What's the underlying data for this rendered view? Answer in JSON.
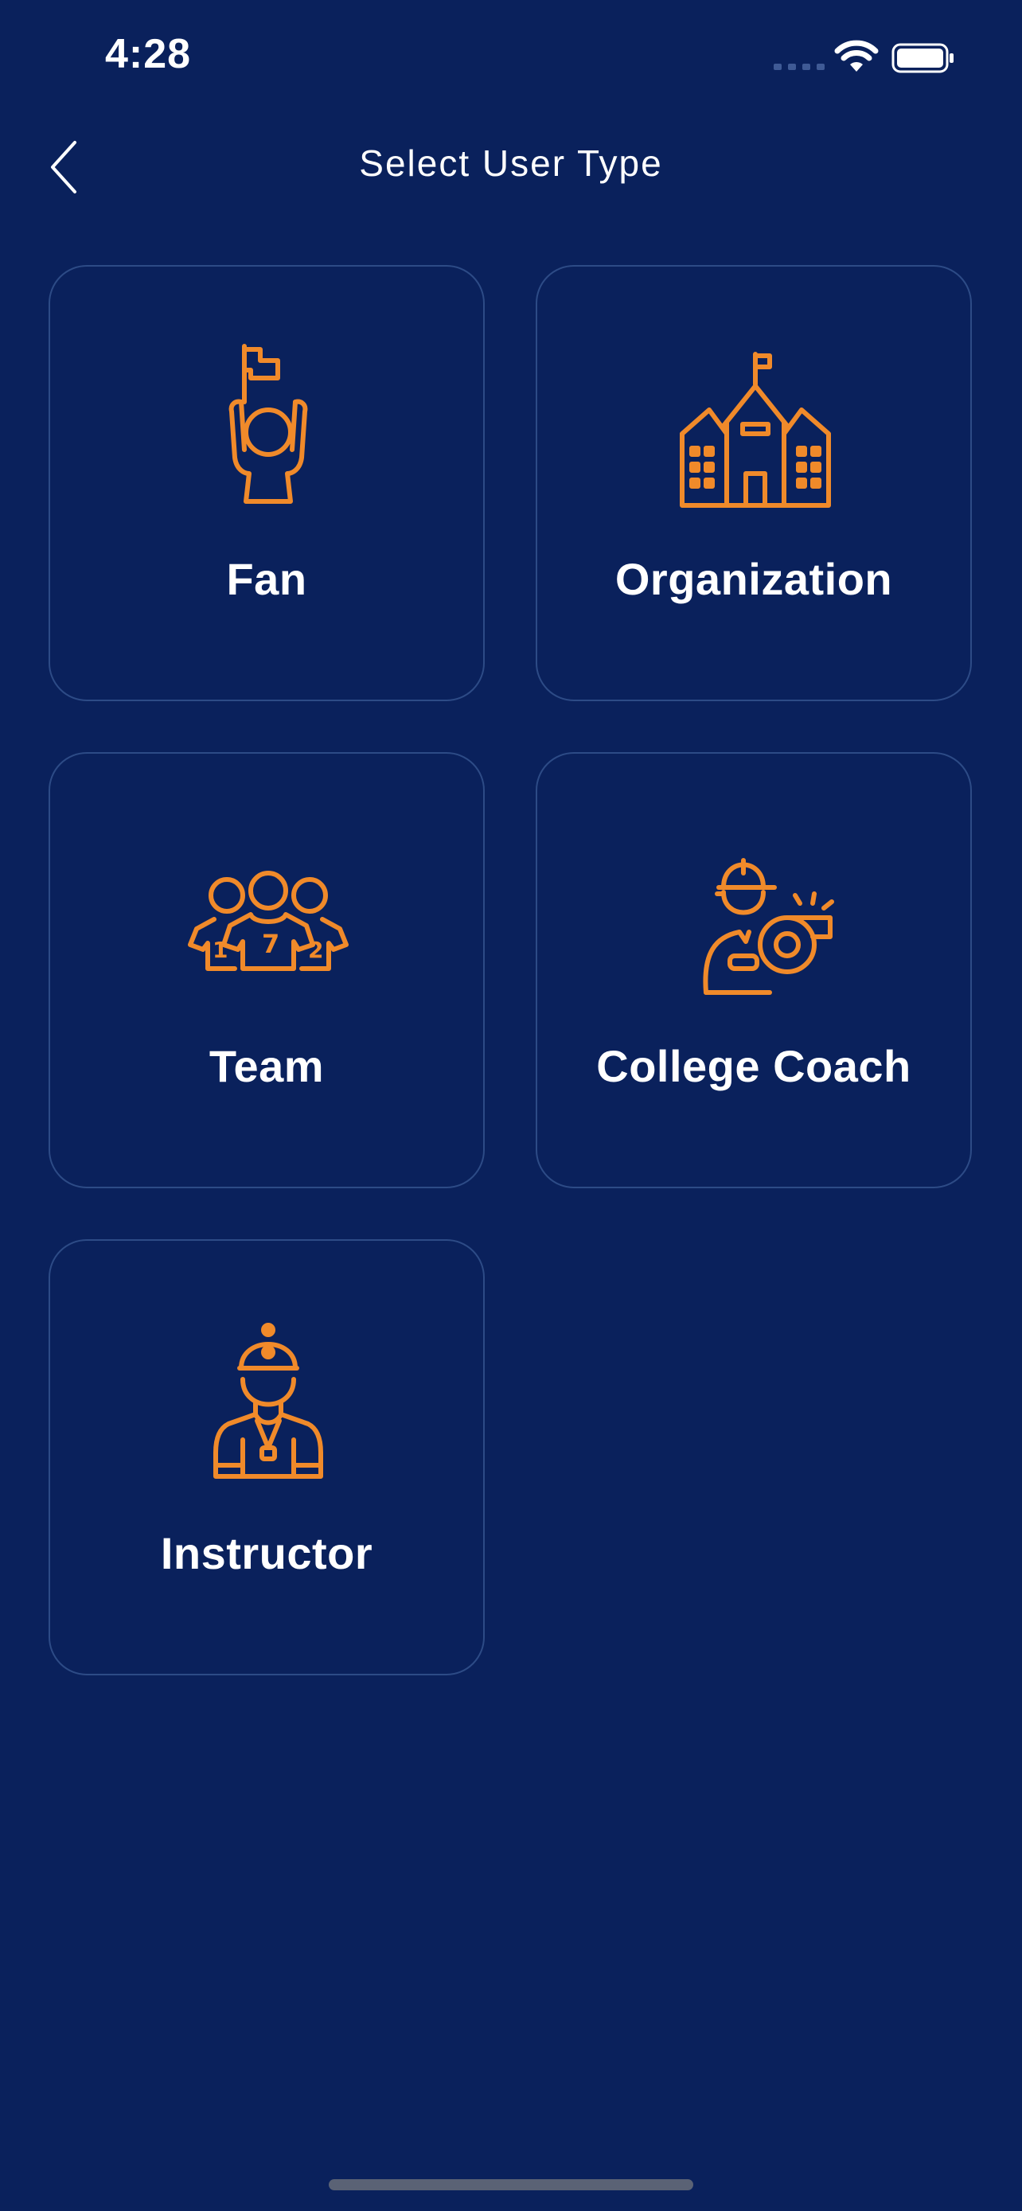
{
  "status_bar": {
    "time": "4:28"
  },
  "header": {
    "title": "Select User Type"
  },
  "cards": [
    {
      "label": "Fan",
      "icon": "fan-flag-icon"
    },
    {
      "label": "Organization",
      "icon": "school-building-icon"
    },
    {
      "label": "Team",
      "icon": "team-players-icon"
    },
    {
      "label": "College Coach",
      "icon": "coach-whistle-icon"
    },
    {
      "label": "Instructor",
      "icon": "instructor-cap-icon"
    }
  ],
  "colors": {
    "background": "#0a215c",
    "card_border": "#2d4b86",
    "icon_accent": "#f08a2a",
    "text": "#ffffff"
  }
}
